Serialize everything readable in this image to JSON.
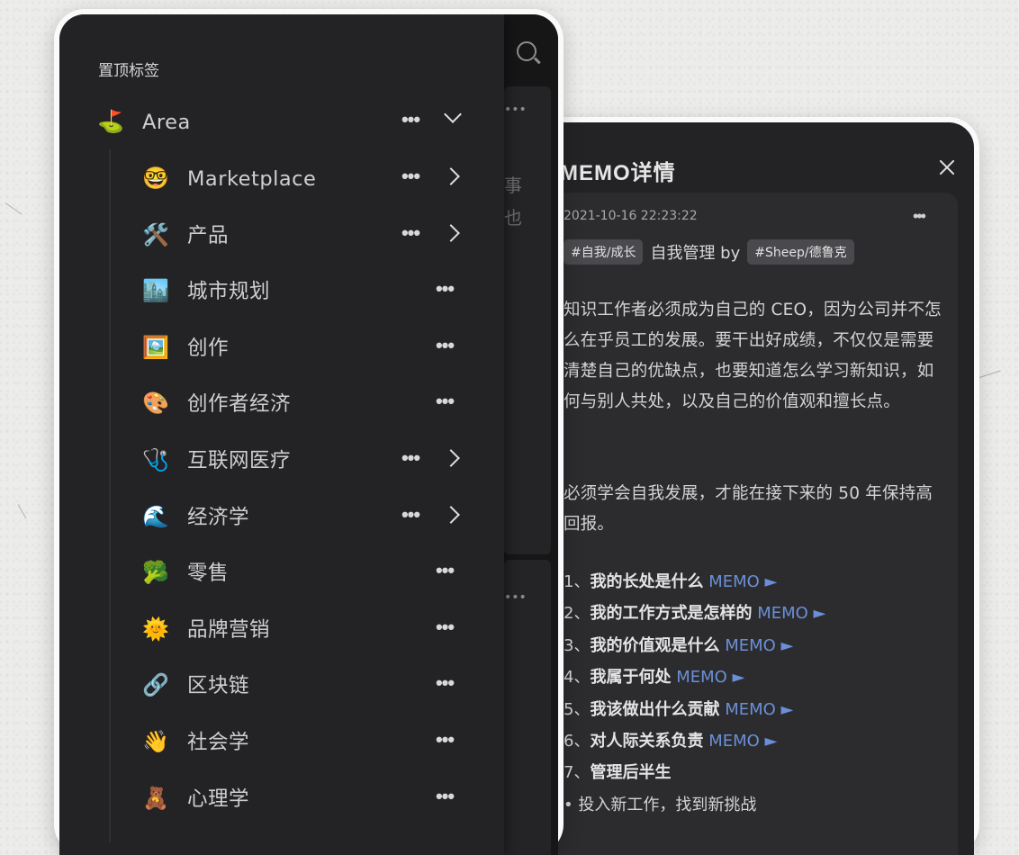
{
  "sidebar": {
    "header": "置顶标签",
    "root": {
      "emoji": "⛳",
      "label": "Area",
      "icon": "flag-in-hole-icon"
    },
    "items": [
      {
        "emoji": "🤓",
        "label": "Marketplace",
        "icon": "nerd-face-icon",
        "has_children": true
      },
      {
        "emoji": "🛠️",
        "label": "产品",
        "icon": "tools-icon",
        "has_children": true
      },
      {
        "emoji": "🏙️",
        "label": "城市规划",
        "icon": "cityscape-icon",
        "has_children": false
      },
      {
        "emoji": "🖼️",
        "label": "创作",
        "icon": "framed-picture-icon",
        "has_children": false
      },
      {
        "emoji": "🎨",
        "label": "创作者经济",
        "icon": "palette-icon",
        "has_children": false
      },
      {
        "emoji": "🩺",
        "label": "互联网医疗",
        "icon": "stethoscope-icon",
        "has_children": true
      },
      {
        "emoji": "🌊",
        "label": "经济学",
        "icon": "wave-icon",
        "has_children": true
      },
      {
        "emoji": "🥦",
        "label": "零售",
        "icon": "broccoli-icon",
        "has_children": false
      },
      {
        "emoji": "🌞",
        "label": "品牌营销",
        "icon": "sun-icon",
        "has_children": false
      },
      {
        "emoji": "🔗",
        "label": "区块链",
        "icon": "link-icon",
        "has_children": false
      },
      {
        "emoji": "👋",
        "label": "社会学",
        "icon": "waving-hand-icon",
        "has_children": false
      },
      {
        "emoji": "🧸",
        "label": "心理学",
        "icon": "teddy-bear-icon",
        "has_children": false
      }
    ],
    "more_glyph": "•••",
    "background_peek": {
      "char1": "事",
      "char2": "也",
      "dots": "•••"
    }
  },
  "memo_detail": {
    "title": "MEMO详情",
    "timestamp": "2021-10-16 22:23:22",
    "more_glyph": "•••",
    "tag1": "#自我/成长",
    "title_text": "自我管理 by",
    "tag2": "#Sheep/德鲁克",
    "paragraph1": "知识工作者必须成为自己的 CEO，因为公司并不怎么在乎员工的发展。要干出好成绩，不仅仅是需要清楚自己的优缺点，也要知道怎么学习新知识，如何与别人共处，以及自己的价值观和擅长点。",
    "paragraph2": "必须学会自我发展，才能在接下来的 50 年保持高回报。",
    "questions": [
      {
        "num": "1、",
        "text": "我的长处是什么",
        "link": "MEMO ►"
      },
      {
        "num": "2、",
        "text": "我的工作方式是怎样的",
        "link": "MEMO ►"
      },
      {
        "num": "3、",
        "text": "我的价值观是什么",
        "link": "MEMO ►"
      },
      {
        "num": "4、",
        "text": "我属于何处",
        "link": "MEMO ►"
      },
      {
        "num": "5、",
        "text": "我该做出什么贡献",
        "link": "MEMO ►"
      },
      {
        "num": "6、",
        "text": "对人际关系负责",
        "link": "MEMO ►"
      },
      {
        "num": "7、",
        "text": "管理后半生",
        "link": ""
      }
    ],
    "bullet": "• 投入新工作，找到新挑战"
  },
  "colors": {
    "accent_link": "#6b8fd6",
    "sidebar_bg": "#232326",
    "card_bg": "#2c2c2f"
  }
}
